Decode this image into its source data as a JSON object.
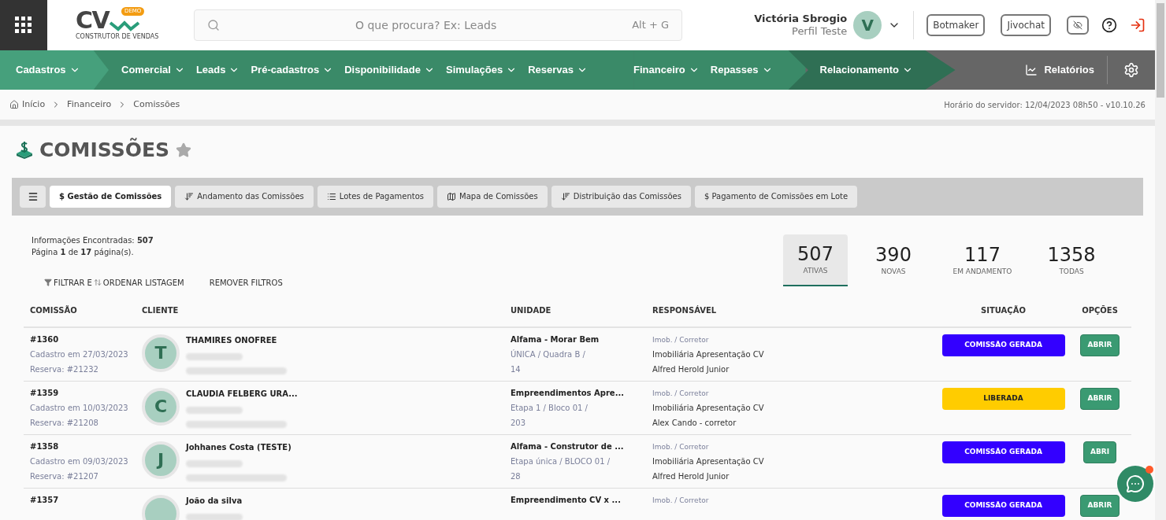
{
  "header": {
    "logo": {
      "mark": "CV",
      "badge": "DEMO",
      "tagline": "CONSTRUTOR DE VENDAS"
    },
    "search": {
      "placeholder": "O que procura? Ex: Leads",
      "shortcut": "Alt + G"
    },
    "user": {
      "name": "Victória Sbrogio",
      "profile": "Perfil Teste",
      "initial": "V"
    },
    "buttons": [
      "Botmaker",
      "Jivochat"
    ]
  },
  "nav": {
    "groups": [
      {
        "kind": "light",
        "items": [
          "Cadastros"
        ]
      },
      {
        "kind": "mid",
        "items": [
          "Comercial",
          "Leads",
          "Pré-cadastros",
          "Disponibilidade",
          "Simulações",
          "Reservas"
        ]
      },
      {
        "kind": "mid",
        "items": [
          "Financeiro",
          "Repasses"
        ]
      },
      {
        "kind": "dark",
        "items": [
          "Relacionamento"
        ]
      }
    ],
    "reports": "Relatórios"
  },
  "breadcrumb": [
    "Início",
    "Financeiro",
    "Comissões"
  ],
  "server_info": "Horário do servidor: 12/04/2023 08h50 - v10.10.26",
  "page_title": "COMISSÕES",
  "tabs": [
    {
      "label": "$ Gestão de Comissões",
      "kind": "plain",
      "selected": true
    },
    {
      "label": "Andamento das Comissões",
      "kind": "sort",
      "selected": false
    },
    {
      "label": "Lotes de Pagamentos",
      "kind": "list",
      "selected": false
    },
    {
      "label": "Mapa de Comissões",
      "kind": "map",
      "selected": false
    },
    {
      "label": "Distribuição das Comissões",
      "kind": "sort",
      "selected": false
    },
    {
      "label": "$ Pagamento de Comissões em Lote",
      "kind": "plain",
      "selected": false
    }
  ],
  "summary": {
    "found": "Informações Encontradas: **507**",
    "page": "Página **1** de **17** página(s)."
  },
  "filters": {
    "filter_label": "FILTRAR E",
    "order_label": "ORDENAR LISTAGEM",
    "remove": "REMOVER FILTROS"
  },
  "stats": [
    {
      "value": "507",
      "label": "ATIVAS",
      "selected": true
    },
    {
      "value": "390",
      "label": "NOVAS",
      "selected": false
    },
    {
      "value": "117",
      "label": "EM ANDAMENTO",
      "selected": false
    },
    {
      "value": "1358",
      "label": "TODAS",
      "selected": false
    }
  ],
  "table": {
    "columns": [
      "COMISSÃO",
      "CLIENTE",
      "UNIDADE",
      "RESPONSÁVEL",
      "SITUAÇÃO",
      "OPÇÕES"
    ],
    "rows": [
      {
        "id": "#1360",
        "created": "Cadastro em 27/03/2023",
        "reservation": "Reserva: #21232",
        "initial": "T",
        "client": "THAMIRES ONOFREE",
        "unit": "Alfama - Morar Bem",
        "unit_detail": "ÚNICA / Quadra B /",
        "unit_number": "14",
        "resp_role": "Imob. / Corretor",
        "agency": "Imobiliária Apresentação CV",
        "agent": "Alfred Herold Junior",
        "status": {
          "text": "COMISSÃO GERADA",
          "kind": "generated"
        },
        "action": "ABRIR"
      },
      {
        "id": "#1359",
        "created": "Cadastro em 10/03/2023",
        "reservation": "Reserva: #21208",
        "initial": "C",
        "client": "CLAUDIA FELBERG URA...",
        "unit": "Empreendimentos Apre...",
        "unit_detail": "Etapa 1 / Bloco 01 /",
        "unit_number": "203",
        "resp_role": "Imob. / Corretor",
        "agency": "Imobiliária Apresentação CV",
        "agent": "Alex Cando - corretor",
        "status": {
          "text": "LIBERADA",
          "kind": "released"
        },
        "action": "ABRIR"
      },
      {
        "id": "#1358",
        "created": "Cadastro em 09/03/2023",
        "reservation": "Reserva: #21207",
        "initial": "J",
        "client": "Johhanes Costa (TESTE)",
        "unit": "Alfama - Construtor de ...",
        "unit_detail": "Etapa única / BLOCO 01 /",
        "unit_number": "28",
        "resp_role": "Imob. / Corretor",
        "agency": "Imobiliária Apresentação CV",
        "agent": "Alfred Herold Junior",
        "status": {
          "text": "COMISSÃO GERADA",
          "kind": "generated"
        },
        "action": "ABRI"
      },
      {
        "id": "#1357",
        "client": "João da silva",
        "unit": "Empreendimento CV x ...",
        "resp_role": "Imob. / Corretor",
        "status": {
          "text": "COMISSÃO GERADA",
          "kind": "generated"
        },
        "action": "ABRIR"
      }
    ]
  }
}
